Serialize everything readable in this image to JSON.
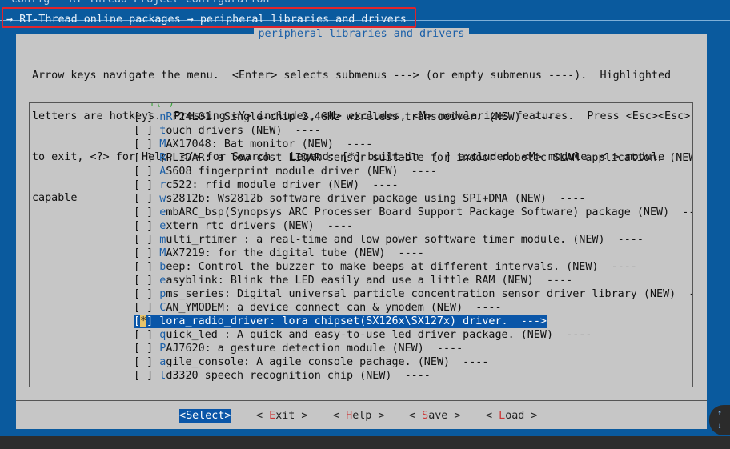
{
  "window": {
    "title": "config - RT-Thread Project Configuration",
    "breadcrumb": "→ RT-Thread online packages → peripheral libraries and drivers"
  },
  "dialog": {
    "title": "peripheral libraries and drivers",
    "help": [
      "Arrow keys navigate the menu.  <Enter> selects submenus ---> (or empty submenus ----).  Highlighted",
      "letters are hotkeys.  Pressing <Y> includes, <N> excludes, <M> modularizes features.  Press <Esc><Esc>",
      "to exit, <?> for Help, </> for Search.  Legend: [*] built-in  [ ] excluded  <M> module  < > module",
      "capable"
    ],
    "scroll_indicator": "↑(-)"
  },
  "items": [
    {
      "mark": "[ ]",
      "hot": "n",
      "hot2": "R",
      "rest": "F24L01: Single-chip 2.4GHz wireless transceiver. (NEW)  ----"
    },
    {
      "mark": "[ ]",
      "hot": "t",
      "rest": "ouch drivers (NEW)  ----"
    },
    {
      "mark": "[ ]",
      "hot": "M",
      "rest": "AX17048: Bat monitor (NEW)  ----"
    },
    {
      "mark": "[ ]",
      "hot": "R",
      "rest": "PLIDAR: a low cost LIDAR sensor suitable for indoor robotic SLAM application. (NEW"
    },
    {
      "mark": "[ ]",
      "hot": "A",
      "rest": "S608 fingerprint module driver (NEW)  ----"
    },
    {
      "mark": "[ ]",
      "hot": "r",
      "rest": "c522: rfid module driver (NEW)  ----"
    },
    {
      "mark": "[ ]",
      "hot": "w",
      "rest": "s2812b: Ws2812b software driver package using SPI+DMA (NEW)  ----"
    },
    {
      "mark": "[ ]",
      "hot": "e",
      "rest": "mbARC_bsp(Synopsys ARC Processer Board Support Package Software) package (NEW)  --"
    },
    {
      "mark": "[ ]",
      "hot": "e",
      "rest": "xtern rtc drivers (NEW)  ----"
    },
    {
      "mark": "[ ]",
      "hot": "m",
      "rest": "ulti_rtimer : a real-time and low power software timer module. (NEW)  ----"
    },
    {
      "mark": "[ ]",
      "hot": "M",
      "rest": "AX7219: for the digital tube (NEW)  ----"
    },
    {
      "mark": "[ ]",
      "hot": "b",
      "rest": "eep: Control the buzzer to make beeps at different intervals. (NEW)  ----"
    },
    {
      "mark": "[ ]",
      "hot": "e",
      "rest": "asyblink: Blink the LED easily and use a little RAM (NEW)  ----"
    },
    {
      "mark": "[ ]",
      "hot": "p",
      "rest": "ms_series: Digital universal particle concentration sensor driver library (NEW)  -"
    },
    {
      "mark": "[ ]",
      "hot": "C",
      "rest": "AN_YMODEM: a device connect can & ymodem (NEW)  ----"
    },
    {
      "mark": "[*]",
      "hot": "l",
      "rest": "ora_radio_driver: lora chipset(SX126x\\SX127x) driver.  --->",
      "selected": true
    },
    {
      "mark": "[ ]",
      "hot": "q",
      "rest": "uick_led : A quick and easy-to-use led driver package. (NEW)  ----"
    },
    {
      "mark": "[ ]",
      "hot": "P",
      "rest": "AJ7620: a gesture detection module (NEW)  ----"
    },
    {
      "mark": "[ ]",
      "hot": "a",
      "rest": "gile_console: A agile console pachage. (NEW)  ----"
    },
    {
      "mark": "[ ]",
      "hot": "l",
      "rest": "d3320 speech recognition chip (NEW)  ----"
    }
  ],
  "buttons": [
    {
      "pre": "<",
      "hot": "S",
      "rest": "elect>",
      "active": true
    },
    {
      "pre": "< ",
      "hot": "E",
      "rest": "xit >"
    },
    {
      "pre": "< ",
      "hot": "H",
      "rest": "elp >"
    },
    {
      "pre": "< ",
      "hot": "S",
      "rest": "ave >"
    },
    {
      "pre": "< ",
      "hot": "L",
      "rest": "oad >"
    }
  ],
  "colors": {
    "background": "#0a5a9e",
    "dialog": "#c6c6c6",
    "selection": "#0a56a8",
    "annotation_box": "#e0242b"
  },
  "overlay": {
    "up": "↑",
    "down": "↓"
  }
}
